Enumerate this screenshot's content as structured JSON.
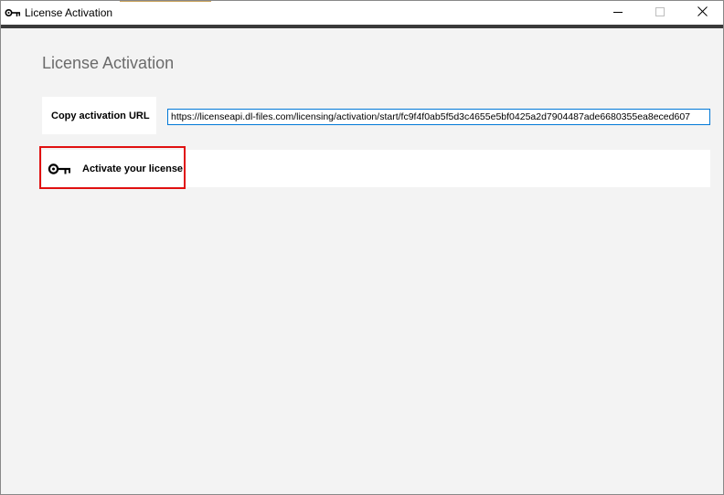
{
  "window": {
    "title": "License Activation",
    "icon": "key-icon",
    "controls": [
      "minimize-icon",
      "maximize-icon",
      "close-icon"
    ]
  },
  "page": {
    "heading": "License Activation"
  },
  "copy_url": {
    "button_label": "Copy activation URL",
    "url_value": "https://licenseapi.dl-files.com/licensing/activation/start/fc9f4f0ab5f5d3c4655e5bf0425a2d7904487ade6680355ea8eced607"
  },
  "activate": {
    "button_label": "Activate your license",
    "icon": "key-icon"
  },
  "colors": {
    "background": "#f3f3f3",
    "panel": "#ffffff",
    "input_border": "#0078d7",
    "highlight": "#e01010",
    "heading": "#6b6b6b"
  }
}
